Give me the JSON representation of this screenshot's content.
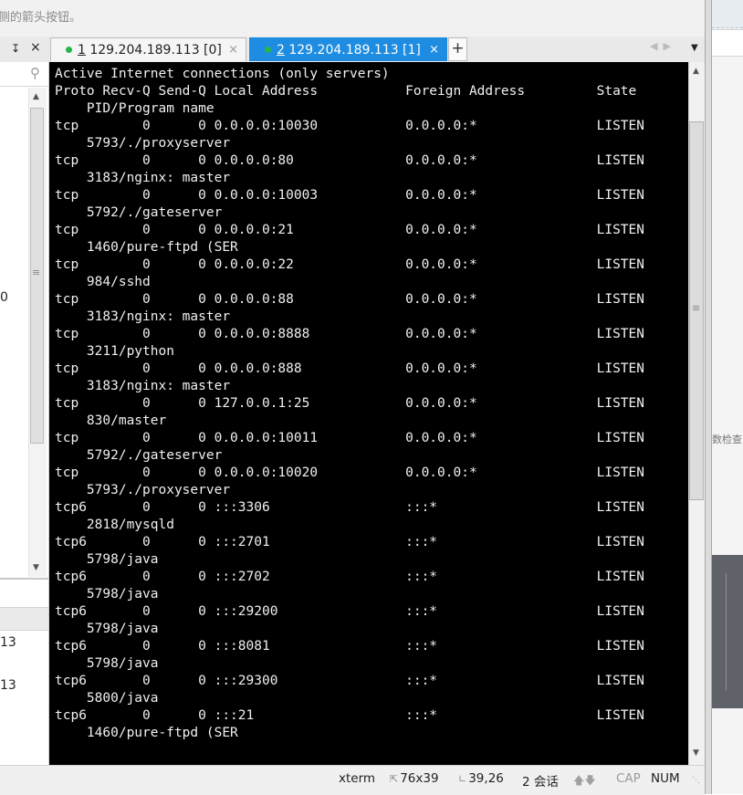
{
  "hint_text": "侧的箭头按钮。",
  "pin_glyph": "↧",
  "panel_close": "×",
  "tabs": [
    {
      "num": "1",
      "title": " 129.204.189.113 [0]",
      "close": "×",
      "active": false
    },
    {
      "num": "2",
      "title": " 129.204.189.113 [1]",
      "close": "×",
      "active": true
    }
  ],
  "add_tab": "+",
  "sidebar": {
    "partial_value": "0",
    "row_values": [
      "13",
      "13"
    ]
  },
  "terminal": {
    "lines": [
      "Active Internet connections (only servers)",
      "Proto Recv-Q Send-Q Local Address           Foreign Address         State",
      "    PID/Program name",
      "tcp        0      0 0.0.0.0:10030           0.0.0.0:*               LISTEN",
      "    5793/./proxyserver",
      "tcp        0      0 0.0.0.0:80              0.0.0.0:*               LISTEN",
      "    3183/nginx: master",
      "tcp        0      0 0.0.0.0:10003           0.0.0.0:*               LISTEN",
      "    5792/./gateserver",
      "tcp        0      0 0.0.0.0:21              0.0.0.0:*               LISTEN",
      "    1460/pure-ftpd (SER",
      "tcp        0      0 0.0.0.0:22              0.0.0.0:*               LISTEN",
      "    984/sshd",
      "tcp        0      0 0.0.0.0:88              0.0.0.0:*               LISTEN",
      "    3183/nginx: master",
      "tcp        0      0 0.0.0.0:8888            0.0.0.0:*               LISTEN",
      "    3211/python",
      "tcp        0      0 0.0.0.0:888             0.0.0.0:*               LISTEN",
      "    3183/nginx: master",
      "tcp        0      0 127.0.0.1:25            0.0.0.0:*               LISTEN",
      "    830/master",
      "tcp        0      0 0.0.0.0:10011           0.0.0.0:*               LISTEN",
      "    5792/./gateserver",
      "tcp        0      0 0.0.0.0:10020           0.0.0.0:*               LISTEN",
      "    5793/./proxyserver",
      "tcp6       0      0 :::3306                 :::*                    LISTEN",
      "    2818/mysqld",
      "tcp6       0      0 :::2701                 :::*                    LISTEN",
      "    5798/java",
      "tcp6       0      0 :::2702                 :::*                    LISTEN",
      "    5798/java",
      "tcp6       0      0 :::29200                :::*                    LISTEN",
      "    5798/java",
      "tcp6       0      0 :::8081                 :::*                    LISTEN",
      "    5798/java",
      "tcp6       0      0 :::29300                :::*                    LISTEN",
      "    5800/java",
      "tcp6       0      0 :::21                   :::*                    LISTEN",
      "    1460/pure-ftpd (SER"
    ]
  },
  "status": {
    "term_type": "xterm",
    "size": "76x39",
    "cursor": "39,26",
    "sessions": "2 会话",
    "cap": "CAP",
    "num": "NUM"
  },
  "right_edge_text": "数检查",
  "colors": {
    "active_tab": "#1e8ce0",
    "session_dot": "#26b64a",
    "terminal_bg": "#000000",
    "terminal_fg": "#f0f0f0"
  }
}
